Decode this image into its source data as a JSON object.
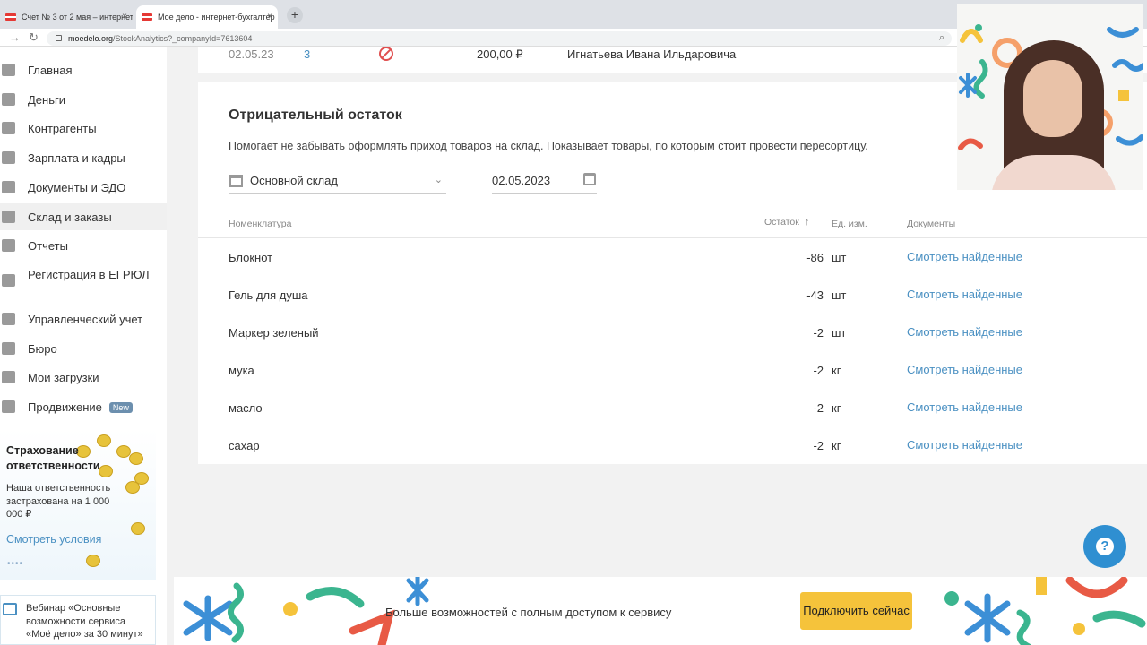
{
  "browser": {
    "tabs": [
      {
        "label": "Счет № 3 от 2 мая – интернет"
      },
      {
        "label": "Мое дело - интернет-бухгалтер"
      }
    ],
    "url_host": "moedelo.org",
    "url_path": "/StockAnalytics?_companyId=7613604"
  },
  "sidebar": {
    "items": [
      {
        "label": "Главная"
      },
      {
        "label": "Деньги"
      },
      {
        "label": "Контрагенты"
      },
      {
        "label": "Зарплата и кадры"
      },
      {
        "label": "Документы и ЭДО"
      },
      {
        "label": "Склад и заказы"
      },
      {
        "label": "Отчеты"
      },
      {
        "label": "Регистрация в ЕГРЮЛ"
      },
      {
        "label": "Управленческий учет"
      },
      {
        "label": "Бюро"
      },
      {
        "label": "Мои загрузки"
      },
      {
        "label": "Продвижение"
      }
    ],
    "new_badge": "New",
    "promo": {
      "title": "Страхование ответственности",
      "text": "Наша ответственность застрахована на 1 000 000 ₽",
      "link": "Смотреть условия",
      "dots": "••••"
    },
    "webinar": {
      "text": "Вебинар «Основные возможности сервиса «Моё дело» за 30 минут»"
    }
  },
  "top_row": {
    "date": "02.05.23",
    "number": "3",
    "sum": "200,00 ₽",
    "name": "Игнатьева Ивана Ильдаровича"
  },
  "card": {
    "title": "Отрицательный остаток",
    "description": "Помогает не забывать оформлять приход товаров на склад. Показывает товары, по которым стоит провести пересортицу.",
    "warehouse": "Основной склад",
    "date": "02.05.2023",
    "columns": {
      "name": "Номенклатура",
      "qty": "Остаток",
      "unit": "Ед. изм.",
      "docs": "Документы"
    },
    "rows": [
      {
        "name": "Блокнот",
        "qty": "-86",
        "unit": "шт",
        "link": "Смотреть найденные"
      },
      {
        "name": "Гель для душа",
        "qty": "-43",
        "unit": "шт",
        "link": "Смотреть найденные"
      },
      {
        "name": "Маркер зеленый",
        "qty": "-2",
        "unit": "шт",
        "link": "Смотреть найденные"
      },
      {
        "name": "мука",
        "qty": "-2",
        "unit": "кг",
        "link": "Смотреть найденные"
      },
      {
        "name": "масло",
        "qty": "-2",
        "unit": "кг",
        "link": "Смотреть найденные"
      },
      {
        "name": "сахар",
        "qty": "-2",
        "unit": "кг",
        "link": "Смотреть найденные"
      }
    ]
  },
  "help": {
    "symbol": "?"
  },
  "banner": {
    "text": "Больше возможностей с полным доступом к сервису",
    "button": "Подключить сейчас"
  },
  "colors": {
    "accent": "#4a90c2",
    "help": "#2f8fd1",
    "cta": "#f5c33b"
  }
}
